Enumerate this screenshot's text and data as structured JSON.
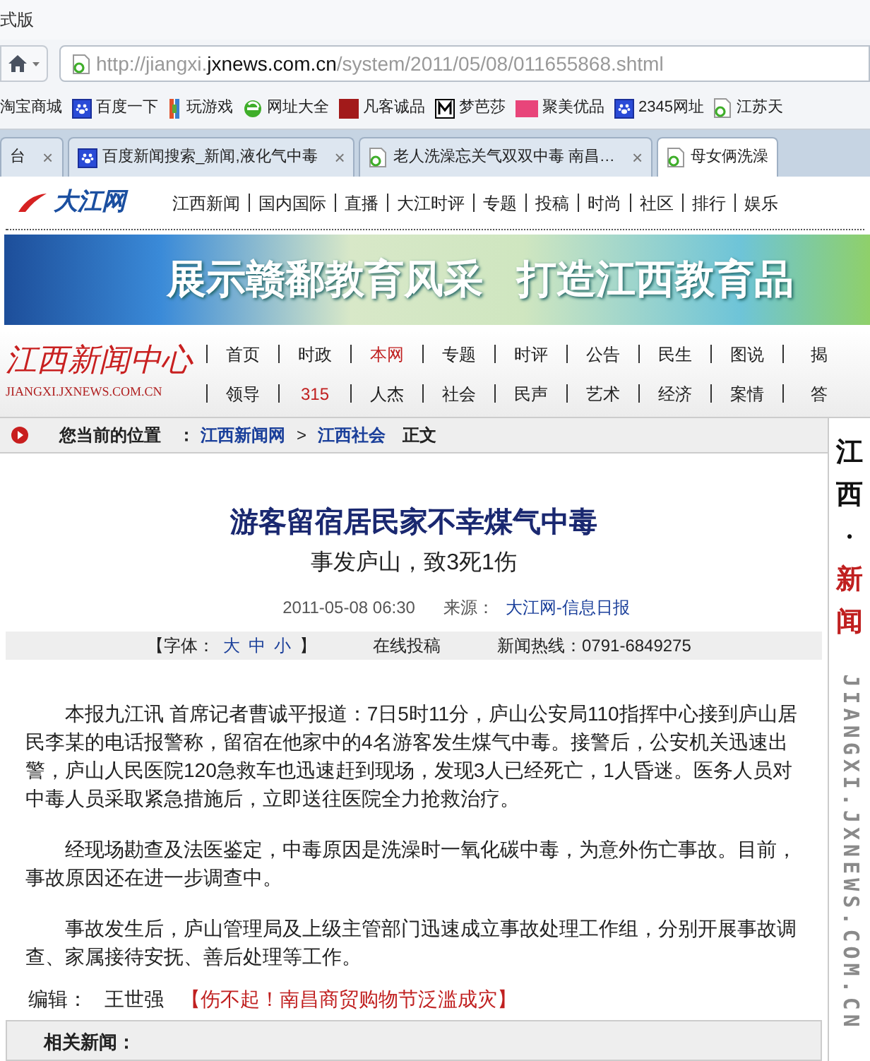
{
  "window": {
    "title": "式版"
  },
  "address_bar": {
    "url_host_prefix": "http://jiangxi.",
    "url_domain": "jxnews.com.cn",
    "url_path": "/system/2011/05/08/011655868.shtml"
  },
  "bookmarks": [
    {
      "label": "淘宝商城",
      "kind": "plain"
    },
    {
      "label": "百度一下",
      "kind": "paw"
    },
    {
      "label": "玩游戏",
      "kind": "game"
    },
    {
      "label": "网址大全",
      "kind": "ie"
    },
    {
      "label": "凡客诚品",
      "kind": "seal"
    },
    {
      "label": "梦芭莎",
      "kind": "m"
    },
    {
      "label": "聚美优品",
      "kind": "logo"
    },
    {
      "label": "2345网址",
      "kind": "paw"
    },
    {
      "label": "江苏天",
      "kind": "page"
    }
  ],
  "tabs": [
    {
      "label": "台",
      "kind": "plain",
      "close": "×",
      "selected": false
    },
    {
      "label": "百度新闻搜索_新闻,液化气中毒",
      "kind": "paw",
      "close": "×",
      "selected": false
    },
    {
      "label": "老人洗澡忘关气双双中毒 南昌…",
      "kind": "page",
      "close": "×",
      "selected": false
    },
    {
      "label": "母女俩洗澡",
      "kind": "page",
      "selected": true
    }
  ],
  "site_header": {
    "logo": "大江网",
    "nav": [
      "江西新闻",
      "国内国际",
      "直播",
      "大江时评",
      "专题",
      "投稿",
      "时尚",
      "社区",
      "排行",
      "娱乐"
    ]
  },
  "banner": {
    "text_1": "展示赣鄱教育风采",
    "text_2": "打造江西教育品"
  },
  "news_center": {
    "logo": "江西新闻中心",
    "logo_domain": "JIANGXI.JXNEWS.COM.CN",
    "nav_rows": [
      [
        {
          "label": "首页",
          "highlighted": false
        },
        {
          "label": "时政",
          "highlighted": false
        },
        {
          "label": "本网",
          "highlighted": true
        },
        {
          "label": "专题",
          "highlighted": false
        },
        {
          "label": "时评",
          "highlighted": false
        },
        {
          "label": "公告",
          "highlighted": false
        },
        {
          "label": "民生",
          "highlighted": false
        },
        {
          "label": "图说",
          "highlighted": false
        },
        {
          "label": "揭",
          "highlighted": false
        }
      ],
      [
        {
          "label": "领导",
          "highlighted": false
        },
        {
          "label": "315",
          "highlighted": true
        },
        {
          "label": "人杰",
          "highlighted": false
        },
        {
          "label": "社会",
          "highlighted": false
        },
        {
          "label": "民声",
          "highlighted": false
        },
        {
          "label": "艺术",
          "highlighted": false
        },
        {
          "label": "经济",
          "highlighted": false
        },
        {
          "label": "案情",
          "highlighted": false
        },
        {
          "label": "答",
          "highlighted": false
        }
      ]
    ]
  },
  "breadcrumb": {
    "label": "您当前的位置",
    "separator": "：",
    "items": [
      "江西新闻网",
      "江西社会"
    ],
    "arrow": ">",
    "current": "正文"
  },
  "article": {
    "title": "游客留宿居民家不幸煤气中毒",
    "subtitle": "事发庐山，致3死1伤",
    "date": "2011-05-08 06:30",
    "source_label": "来源：",
    "source": "大江网-信息日报",
    "tools": {
      "font_open": "【字体：",
      "font_sizes": [
        "大",
        "中",
        "小"
      ],
      "font_close": "】",
      "submit": "在线投稿",
      "hotline": "新闻热线：0791-6849275"
    },
    "paragraphs": [
      "本报九江讯 首席记者曹诚平报道：7日5时11分，庐山公安局110指挥中心接到庐山居民李某的电话报警称，留宿在他家中的4名游客发生煤气中毒。接警后，公安机关迅速出警，庐山人民医院120急救车也迅速赶到现场，发现3人已经死亡，1人昏迷。医务人员对中毒人员采取紧急措施后，立即送往医院全力抢救治疗。",
      "经现场勘查及法医鉴定，中毒原因是洗澡时一氧化碳中毒，为意外伤亡事故。目前，事故原因还在进一步调查中。",
      "事故发生后，庐山管理局及上级主管部门迅速成立事故处理工作组，分别开展事故调查、家属接待安抚、善后处理等工作。"
    ],
    "editor_label": "编辑：",
    "editor": "王世强",
    "promo_link": "【伤不起！南昌商贸购物节泛滥成灾】",
    "related": "相关新闻："
  },
  "sidebar": {
    "chars": [
      {
        "text": "江",
        "highlighted": false
      },
      {
        "text": "西",
        "highlighted": false
      },
      {
        "text": "·",
        "highlighted": false
      },
      {
        "text": "新",
        "highlighted": true
      },
      {
        "text": "闻",
        "highlighted": true
      }
    ],
    "domain": "JIANGXI.JXNEWS.COM.CN"
  }
}
